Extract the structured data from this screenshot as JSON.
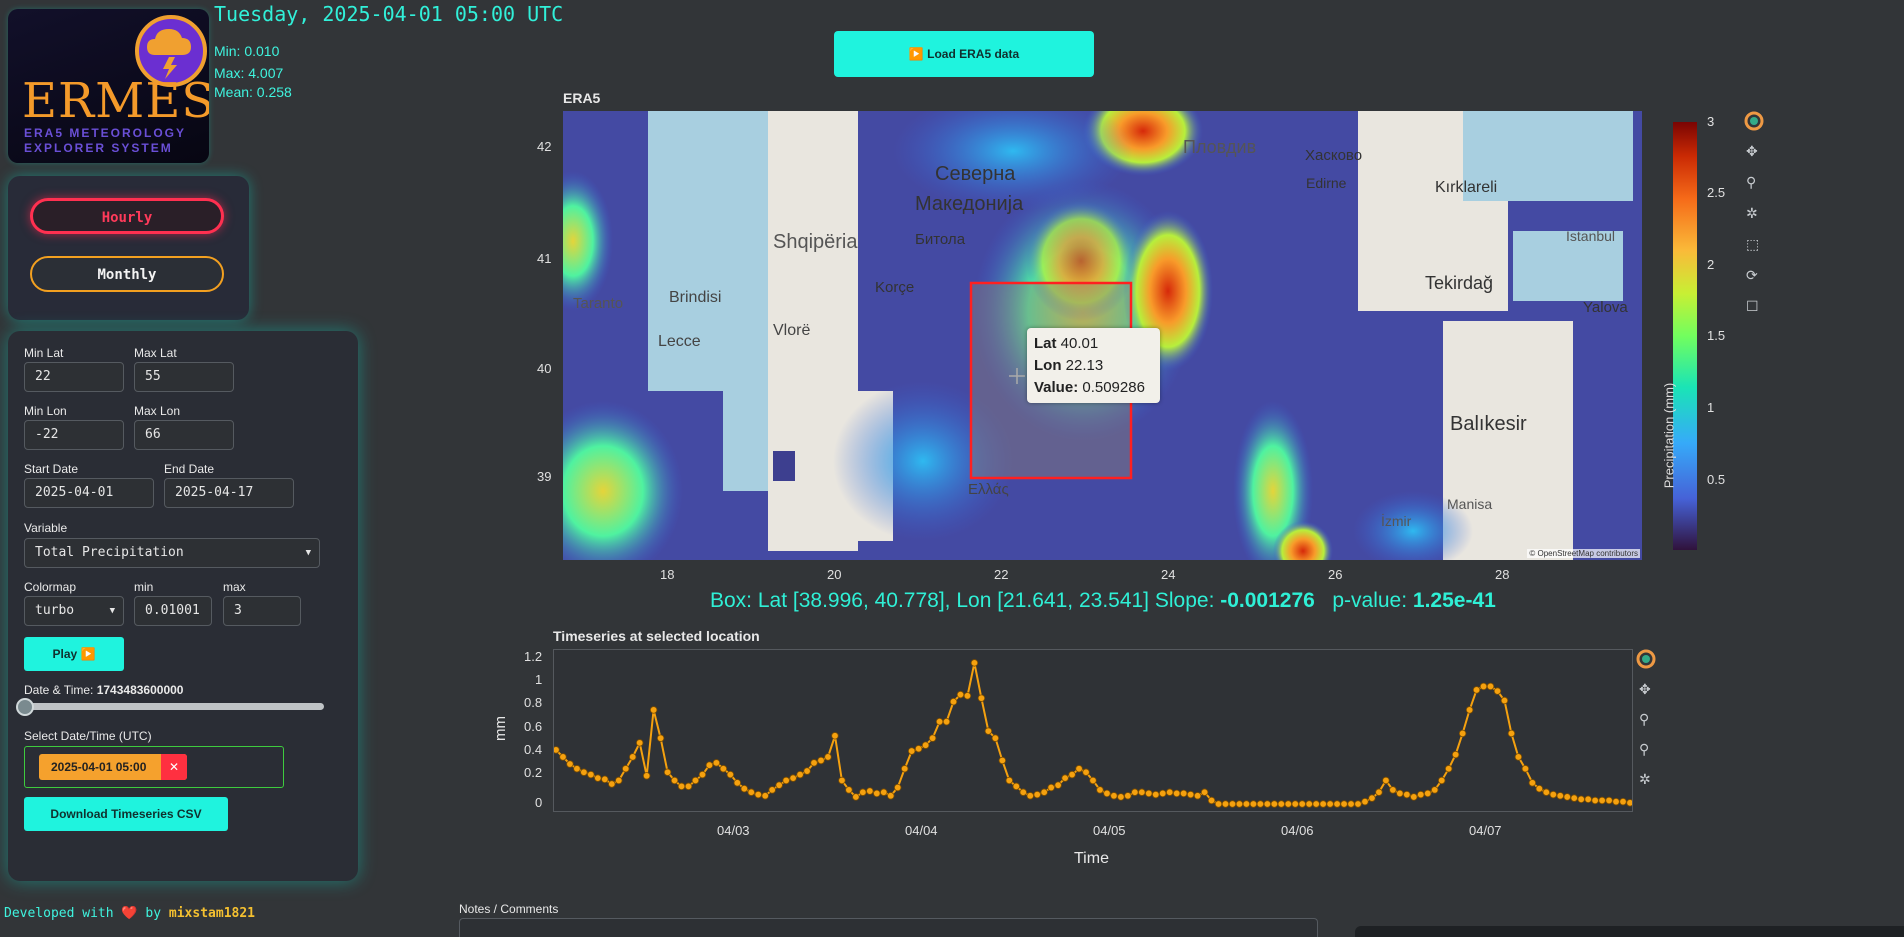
{
  "logo": {
    "wordmark": "ERMES",
    "subtitle_line1": "ERA5 METEOROLOGY",
    "subtitle_line2": "EXPLORER SYSTEM"
  },
  "header": {
    "datetime": "Tuesday, 2025-04-01 05:00 UTC",
    "min": "Min: 0.010",
    "max": "Max: 4.007",
    "mean": "Mean: 0.258",
    "load_button": "▶️ Load ERA5 data"
  },
  "mode": {
    "hourly": "Hourly",
    "monthly": "Monthly",
    "active": "Hourly"
  },
  "controls": {
    "min_lat_label": "Min Lat",
    "min_lat": "22",
    "max_lat_label": "Max Lat",
    "max_lat": "55",
    "min_lon_label": "Min Lon",
    "min_lon": "-22",
    "max_lon_label": "Max Lon",
    "max_lon": "66",
    "start_date_label": "Start Date",
    "start_date": "2025-04-01",
    "end_date_label": "End Date",
    "end_date": "2025-04-17",
    "variable_label": "Variable",
    "variable": "Total Precipitation",
    "colormap_label": "Colormap",
    "colormap": "turbo",
    "min_label": "min",
    "min": "0.01001",
    "max_label": "max",
    "max": "3",
    "play_button": "Play ▶️",
    "datetime_label": "Date & Time:",
    "datetime_value": "1743483600000",
    "slider_fraction": 0.0,
    "select_dt_label": "Select Date/Time (UTC)",
    "selected_tag": "2025-04-01 05:00",
    "remove_tag": "✕",
    "download_button": "Download Timeseries CSV"
  },
  "map": {
    "title": "ERA5",
    "y_ticks": [
      "42",
      "41",
      "40",
      "39"
    ],
    "x_ticks": [
      "18",
      "20",
      "22",
      "24",
      "26",
      "28"
    ],
    "labels": [
      {
        "text": "Shqipëria"
      },
      {
        "text": "Brindisi"
      },
      {
        "text": "Lecce"
      },
      {
        "text": "Taranto"
      },
      {
        "text": "Korçe"
      },
      {
        "text": "Vlorë"
      },
      {
        "text": "Битола"
      },
      {
        "text": "Северна"
      },
      {
        "text": "Македонија"
      },
      {
        "text": "Пловдив"
      },
      {
        "text": "Хасково"
      },
      {
        "text": "Edirne"
      },
      {
        "text": "Kırklareli"
      },
      {
        "text": "Tekirdağ"
      },
      {
        "text": "Istanbul"
      },
      {
        "text": "Yalova"
      },
      {
        "text": "Balıkesir"
      },
      {
        "text": "İzmir"
      },
      {
        "text": "Manisa"
      },
      {
        "text": "Ελλάς"
      }
    ],
    "attribution": "© OpenStreetMap contributors",
    "selected_box": {
      "lat": [
        38.996,
        40.778
      ],
      "lon": [
        21.641,
        23.541
      ]
    }
  },
  "colorbar": {
    "label": "Precipitation (mm)",
    "ticks": [
      "3",
      "2.5",
      "2",
      "1.5",
      "1",
      "0.5"
    ],
    "colormap": "turbo",
    "range": [
      0,
      3
    ]
  },
  "tooltip": {
    "lat_label": "Lat",
    "lat": "40.01",
    "lon_label": "Lon",
    "lon": "22.13",
    "value_label": "Value:",
    "value": "0.509286"
  },
  "box_info": {
    "prefix": "Box: Lat [38.996, 40.778], Lon [21.641, 23.541] Slope:",
    "slope": "-0.001276",
    "pvalue_label": "p-value:",
    "pvalue": "1.25e-41"
  },
  "timeseries": {
    "title": "Timeseries at selected location",
    "ylabel": "mm",
    "xlabel": "Time",
    "y_ticks": [
      "1.2",
      "1",
      "0.8",
      "0.6",
      "0.4",
      "0.2",
      "0"
    ],
    "x_ticks": [
      "04/03",
      "04/04",
      "04/05",
      "04/06",
      "04/07"
    ]
  },
  "chart_data": {
    "type": "line",
    "title": "Timeseries at selected location",
    "xlabel": "Time",
    "ylabel": "mm",
    "ylim": [
      0,
      1.25
    ],
    "x_start": "2025-04-02T06:00",
    "x_step_hours": 1,
    "series": [
      {
        "values": [
          0.46,
          0.4,
          0.34,
          0.3,
          0.27,
          0.25,
          0.22,
          0.21,
          0.17,
          0.2,
          0.3,
          0.4,
          0.52,
          0.24,
          0.8,
          0.56,
          0.27,
          0.2,
          0.15,
          0.15,
          0.2,
          0.25,
          0.33,
          0.35,
          0.3,
          0.25,
          0.18,
          0.13,
          0.1,
          0.08,
          0.07,
          0.12,
          0.16,
          0.2,
          0.22,
          0.25,
          0.28,
          0.35,
          0.37,
          0.4,
          0.58,
          0.2,
          0.12,
          0.06,
          0.1,
          0.11,
          0.09,
          0.1,
          0.07,
          0.14,
          0.3,
          0.45,
          0.47,
          0.5,
          0.56,
          0.7,
          0.7,
          0.87,
          0.93,
          0.92,
          1.2,
          0.9,
          0.62,
          0.56,
          0.37,
          0.2,
          0.15,
          0.1,
          0.07,
          0.08,
          0.1,
          0.14,
          0.16,
          0.22,
          0.25,
          0.3,
          0.27,
          0.2,
          0.12,
          0.09,
          0.07,
          0.06,
          0.07,
          0.1,
          0.1,
          0.09,
          0.08,
          0.09,
          0.1,
          0.09,
          0.09,
          0.08,
          0.07,
          0.1,
          0.03,
          0,
          0,
          0,
          0,
          0,
          0,
          0,
          0,
          0,
          0,
          0,
          0,
          0,
          0,
          0,
          0,
          0,
          0,
          0,
          0,
          0,
          0.02,
          0.05,
          0.1,
          0.2,
          0.12,
          0.09,
          0.08,
          0.06,
          0.08,
          0.09,
          0.12,
          0.2,
          0.3,
          0.42,
          0.6,
          0.8,
          0.97,
          1.0,
          1.0,
          0.96,
          0.88,
          0.6,
          0.4,
          0.3,
          0.18,
          0.13,
          0.1,
          0.08,
          0.07,
          0.06,
          0.05,
          0.04,
          0.04,
          0.03,
          0.03,
          0.03,
          0.02,
          0.02,
          0.01
        ]
      }
    ]
  },
  "notes_label": "Notes / Comments",
  "footer": {
    "text": "Developed with ❤️ by",
    "author": "mixstam1821"
  }
}
